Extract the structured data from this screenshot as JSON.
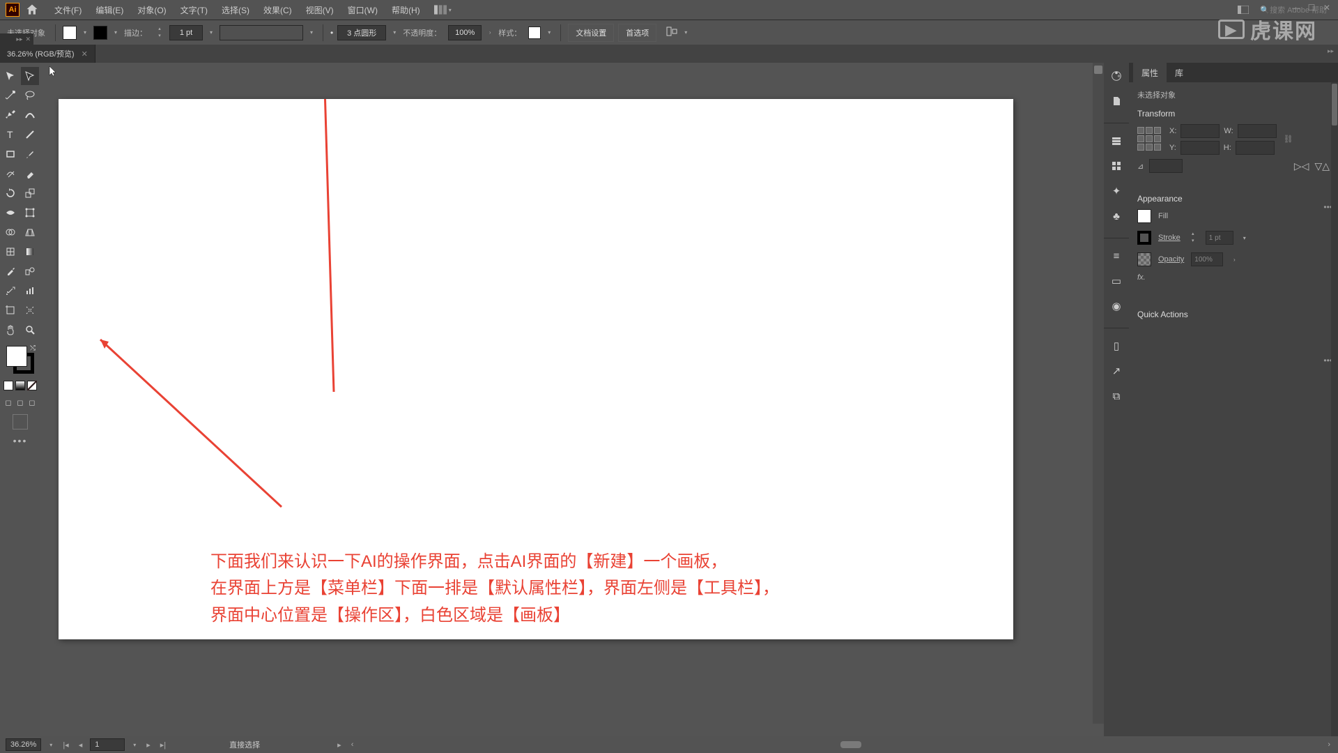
{
  "menubar": {
    "app_icon": "Ai",
    "items": [
      "文件(F)",
      "编辑(E)",
      "对象(O)",
      "文字(T)",
      "选择(S)",
      "效果(C)",
      "视图(V)",
      "窗口(W)",
      "帮助(H)"
    ],
    "search_placeholder": "搜索 Adobe 帮助"
  },
  "propbar": {
    "no_selection": "未选择对象",
    "stroke_label": "描边：",
    "stroke_value": "1 pt",
    "brush_value": "3 点圆形",
    "opacity_label": "不透明度：",
    "opacity_value": "100%",
    "style_label": "样式：",
    "doc_setup": "文档设置",
    "prefs": "首选项"
  },
  "tab": {
    "title": "36.26% (RGB/预览)"
  },
  "tools": {
    "rows": [
      [
        "selection",
        "direct-selection"
      ],
      [
        "magic-wand",
        "lasso"
      ],
      [
        "pen",
        "curvature"
      ],
      [
        "type",
        "line"
      ],
      [
        "rectangle",
        "paintbrush"
      ],
      [
        "shaper",
        "eraser"
      ],
      [
        "rotate",
        "scale"
      ],
      [
        "width",
        "free-transform"
      ],
      [
        "shape-builder",
        "perspective"
      ],
      [
        "mesh",
        "gradient"
      ],
      [
        "eyedropper",
        "blend"
      ],
      [
        "symbol-sprayer",
        "column-graph"
      ],
      [
        "artboard",
        "slice"
      ],
      [
        "hand",
        "zoom"
      ]
    ]
  },
  "side_icons": [
    "palette",
    "page",
    "row",
    "grid",
    "brush",
    "club",
    "lines",
    "win",
    "circle",
    "panel",
    "share",
    "copy"
  ],
  "panel": {
    "tabs": [
      "属性",
      "库"
    ],
    "no_selection": "未选择对象",
    "transform": "Transform",
    "x_label": "X:",
    "y_label": "Y:",
    "w_label": "W:",
    "h_label": "H:",
    "x_val": "",
    "y_val": "",
    "w_val": "",
    "h_val": "",
    "appearance": "Appearance",
    "fill": "Fill",
    "stroke": "Stroke",
    "stroke_val": "1 pt",
    "opacity": "Opacity",
    "opacity_val": "100%",
    "fx": "fx.",
    "quick_actions": "Quick Actions"
  },
  "status": {
    "zoom": "36.26%",
    "artboard": "1",
    "tool_hint": "直接选择"
  },
  "canvas_annotation": {
    "line1": "下面我们来认识一下AI的操作界面，点击AI界面的【新建】一个画板，",
    "line2": "在界面上方是【菜单栏】下面一排是【默认属性栏】，界面左侧是【工具栏】，",
    "line3": "界面中心位置是【操作区】，白色区域是【画板】"
  },
  "watermark": "虎课网"
}
